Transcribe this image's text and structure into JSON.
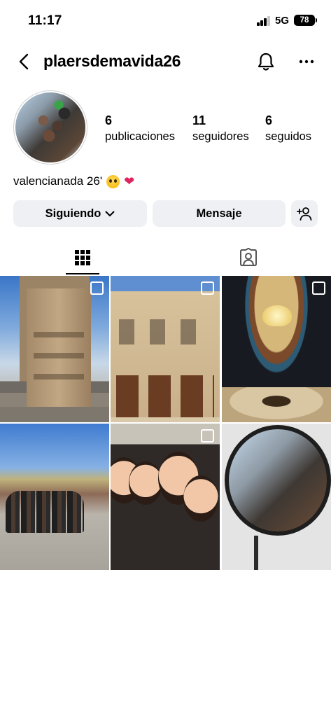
{
  "status_bar": {
    "time": "11:17",
    "network": "5G",
    "battery": "78"
  },
  "header": {
    "username": "plaersdemavida26",
    "icons": [
      "back-arrow-icon",
      "bell-icon",
      "more-dots-icon"
    ]
  },
  "profile": {
    "stats": [
      {
        "value": "6",
        "label": "publicaciones"
      },
      {
        "value": "11",
        "label": "seguidores"
      },
      {
        "value": "6",
        "label": "seguidos"
      }
    ],
    "bio": "valencianada 26'",
    "bio_emojis": [
      "pleading-face-emoji",
      "heart-on-fire-emoji"
    ]
  },
  "actions": {
    "following_label": "Siguiendo",
    "message_label": "Mensaje",
    "add_person_icon": "add-person-icon"
  },
  "tabs": [
    {
      "icon": "grid-icon",
      "selected": true
    },
    {
      "icon": "tagged-person-icon",
      "selected": false
    }
  ],
  "posts": [
    {
      "subject": "historic stone tower building",
      "multi": true
    },
    {
      "subject": "theater facade",
      "multi": true
    },
    {
      "subject": "grand hall with chandelier",
      "multi": true
    },
    {
      "subject": "group photo on plaza",
      "multi": false
    },
    {
      "subject": "group selfie",
      "multi": true
    },
    {
      "subject": "mirror selfie",
      "multi": false
    }
  ],
  "colors": {
    "button_bg": "#eef0f3",
    "text": "#000000"
  }
}
